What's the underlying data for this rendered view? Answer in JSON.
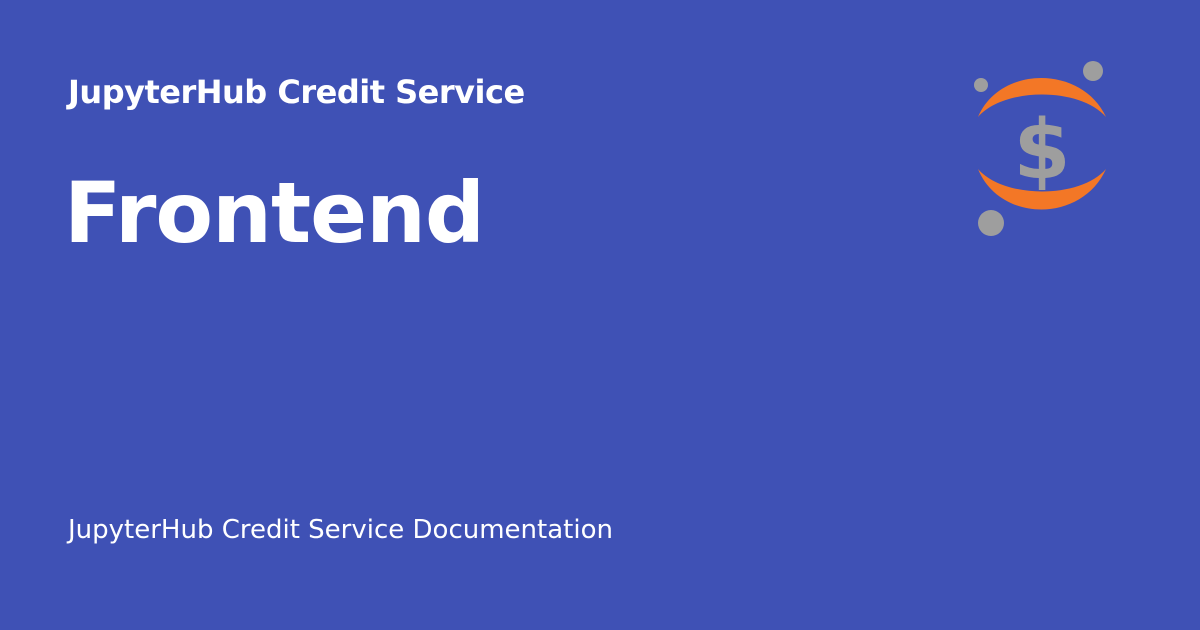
{
  "card": {
    "site_name": "JupyterHub Credit Service",
    "page_title": "Frontend",
    "footer": "JupyterHub Credit Service Documentation"
  },
  "logo": {
    "icon": "dollar-orbit-logo-icon",
    "symbol": "$"
  },
  "colors": {
    "background": "#3f51b5",
    "text": "#ffffff",
    "logo_orange": "#f37726",
    "logo_gray": "#9e9e9e"
  }
}
